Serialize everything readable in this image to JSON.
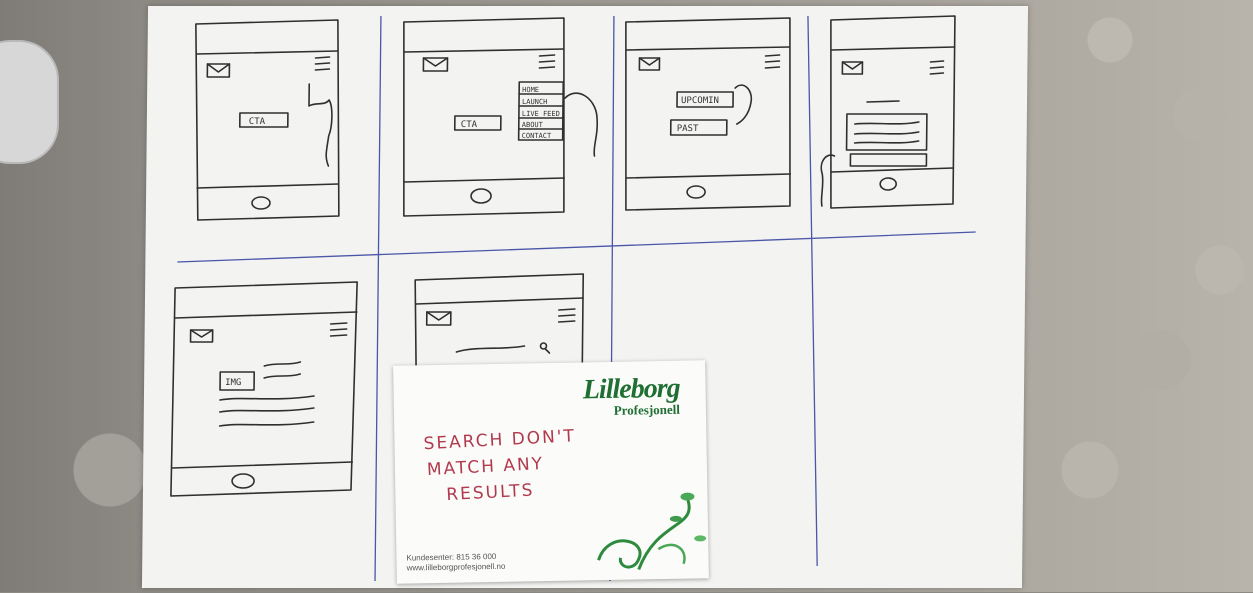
{
  "sketches": {
    "frame1": {
      "button_label": "CTA"
    },
    "frame2": {
      "button_label": "CTA",
      "menu_items": [
        "HOME",
        "LAUNCH",
        "LIVE FEED",
        "ABOUT",
        "CONTACT"
      ]
    },
    "frame3": {
      "buttons": [
        "UPCOMIN",
        "PAST"
      ]
    },
    "frame5": {
      "image_label": "IMG"
    }
  },
  "sticky_note": {
    "brand_name": "Lilleborg",
    "brand_subtitle": "Profesjonell",
    "message_lines": [
      "SEARCH DON'T",
      "MATCH ANY",
      "RESULTS"
    ],
    "contact_line1": "Kundesenter: 815 36 000",
    "contact_line2": "www.lilleborgprofesjonell.no"
  },
  "colors": {
    "paper": "#f3f3f2",
    "pencil": "#2f2f2f",
    "grid_line": "#4a56a8",
    "note_ink": "#b13a4d",
    "brand_green": "#1f6e32"
  }
}
